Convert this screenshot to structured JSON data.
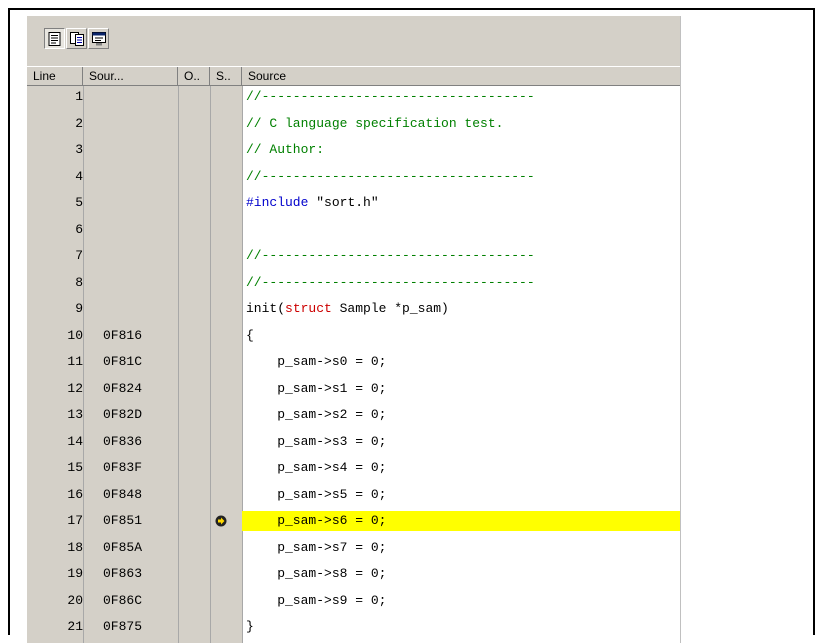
{
  "toolbar": {
    "buttons": [
      {
        "icon": "source-view-icon"
      },
      {
        "icon": "mixed-view-icon"
      },
      {
        "icon": "disassembly-view-icon"
      }
    ]
  },
  "columns": [
    "Line",
    "Sour...",
    "O..",
    "S..",
    "Source"
  ],
  "current_line": 17,
  "highlight_color": "#ffff00",
  "lines": [
    {
      "line": "1",
      "addr": "",
      "src": "//-----------------------------------",
      "kind": "comment"
    },
    {
      "line": "2",
      "addr": "",
      "src": "// C language specification test.",
      "kind": "comment"
    },
    {
      "line": "3",
      "addr": "",
      "src": "// Author:",
      "kind": "comment"
    },
    {
      "line": "4",
      "addr": "",
      "src": "//-----------------------------------",
      "kind": "comment"
    },
    {
      "line": "5",
      "addr": "",
      "src": "\"sort.h\"",
      "kind": "include",
      "directive": "#include"
    },
    {
      "line": "6",
      "addr": "",
      "src": "",
      "kind": "plain"
    },
    {
      "line": "7",
      "addr": "",
      "src": "//-----------------------------------",
      "kind": "comment"
    },
    {
      "line": "8",
      "addr": "",
      "src": "//-----------------------------------",
      "kind": "comment"
    },
    {
      "line": "9",
      "addr": "",
      "pre": "init(",
      "keyword": "struct",
      "src": " Sample *p_sam)",
      "kind": "keyword"
    },
    {
      "line": "10",
      "addr": "0F816",
      "src": "{",
      "kind": "plain"
    },
    {
      "line": "11",
      "addr": "0F81C",
      "src": "    p_sam->s0 = 0;",
      "kind": "plain"
    },
    {
      "line": "12",
      "addr": "0F824",
      "src": "    p_sam->s1 = 0;",
      "kind": "plain"
    },
    {
      "line": "13",
      "addr": "0F82D",
      "src": "    p_sam->s2 = 0;",
      "kind": "plain"
    },
    {
      "line": "14",
      "addr": "0F836",
      "src": "    p_sam->s3 = 0;",
      "kind": "plain"
    },
    {
      "line": "15",
      "addr": "0F83F",
      "src": "    p_sam->s4 = 0;",
      "kind": "plain"
    },
    {
      "line": "16",
      "addr": "0F848",
      "src": "    p_sam->s5 = 0;",
      "kind": "plain"
    },
    {
      "line": "17",
      "addr": "0F851",
      "src": "    p_sam->s6 = 0;",
      "kind": "plain"
    },
    {
      "line": "18",
      "addr": "0F85A",
      "src": "    p_sam->s7 = 0;",
      "kind": "plain"
    },
    {
      "line": "19",
      "addr": "0F863",
      "src": "    p_sam->s8 = 0;",
      "kind": "plain"
    },
    {
      "line": "20",
      "addr": "0F86C",
      "src": "    p_sam->s9 = 0;",
      "kind": "plain"
    },
    {
      "line": "21",
      "addr": "0F875",
      "src": "}",
      "kind": "plain"
    }
  ]
}
